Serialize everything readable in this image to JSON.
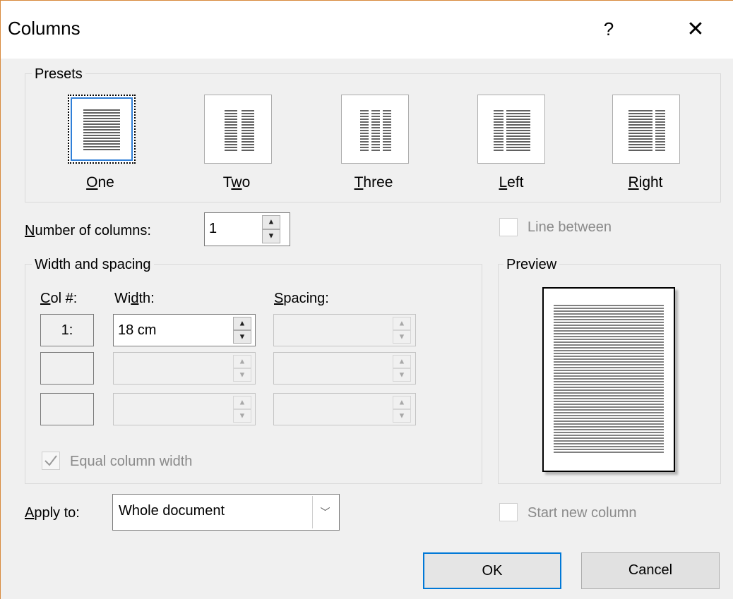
{
  "dialog": {
    "title": "Columns",
    "help_label": "?",
    "close_label": "✕"
  },
  "presets": {
    "group_label": "Presets",
    "items": [
      {
        "pre": "",
        "accel": "O",
        "post": "ne",
        "selected": true
      },
      {
        "pre": "T",
        "accel": "w",
        "post": "o",
        "selected": false
      },
      {
        "pre": "",
        "accel": "T",
        "post": "hree",
        "selected": false
      },
      {
        "pre": "",
        "accel": "L",
        "post": "eft",
        "selected": false
      },
      {
        "pre": "",
        "accel": "R",
        "post": "ight",
        "selected": false
      }
    ]
  },
  "number_of_columns": {
    "label_accel": "N",
    "label_rest": "umber of columns:",
    "value": "1"
  },
  "line_between": {
    "label": "Line between",
    "checked": false,
    "enabled": false
  },
  "width_spacing": {
    "group_label": "Width and spacing",
    "col_header_accel": "C",
    "col_header_rest": "ol #:",
    "width_header_pre": "Wi",
    "width_header_accel": "d",
    "width_header_post": "th:",
    "spacing_header_accel": "S",
    "spacing_header_rest": "pacing:",
    "rows": [
      {
        "col": "1:",
        "width": "18 cm",
        "spacing": "",
        "width_enabled": true
      },
      {
        "col": "",
        "width": "",
        "spacing": "",
        "width_enabled": false
      },
      {
        "col": "",
        "width": "",
        "spacing": "",
        "width_enabled": false
      }
    ],
    "equal_width_label": "Equal column width",
    "equal_width_checked": true
  },
  "preview": {
    "group_label": "Preview"
  },
  "apply_to": {
    "label_accel": "A",
    "label_rest": "pply to:",
    "value": "Whole document"
  },
  "start_new_column": {
    "label": "Start new column",
    "checked": false,
    "enabled": false
  },
  "buttons": {
    "ok": "OK",
    "cancel": "Cancel"
  },
  "colors": {
    "accent": "#0078d7",
    "disabled_text": "#8a8a8a",
    "window_border": "#d88a3d"
  }
}
